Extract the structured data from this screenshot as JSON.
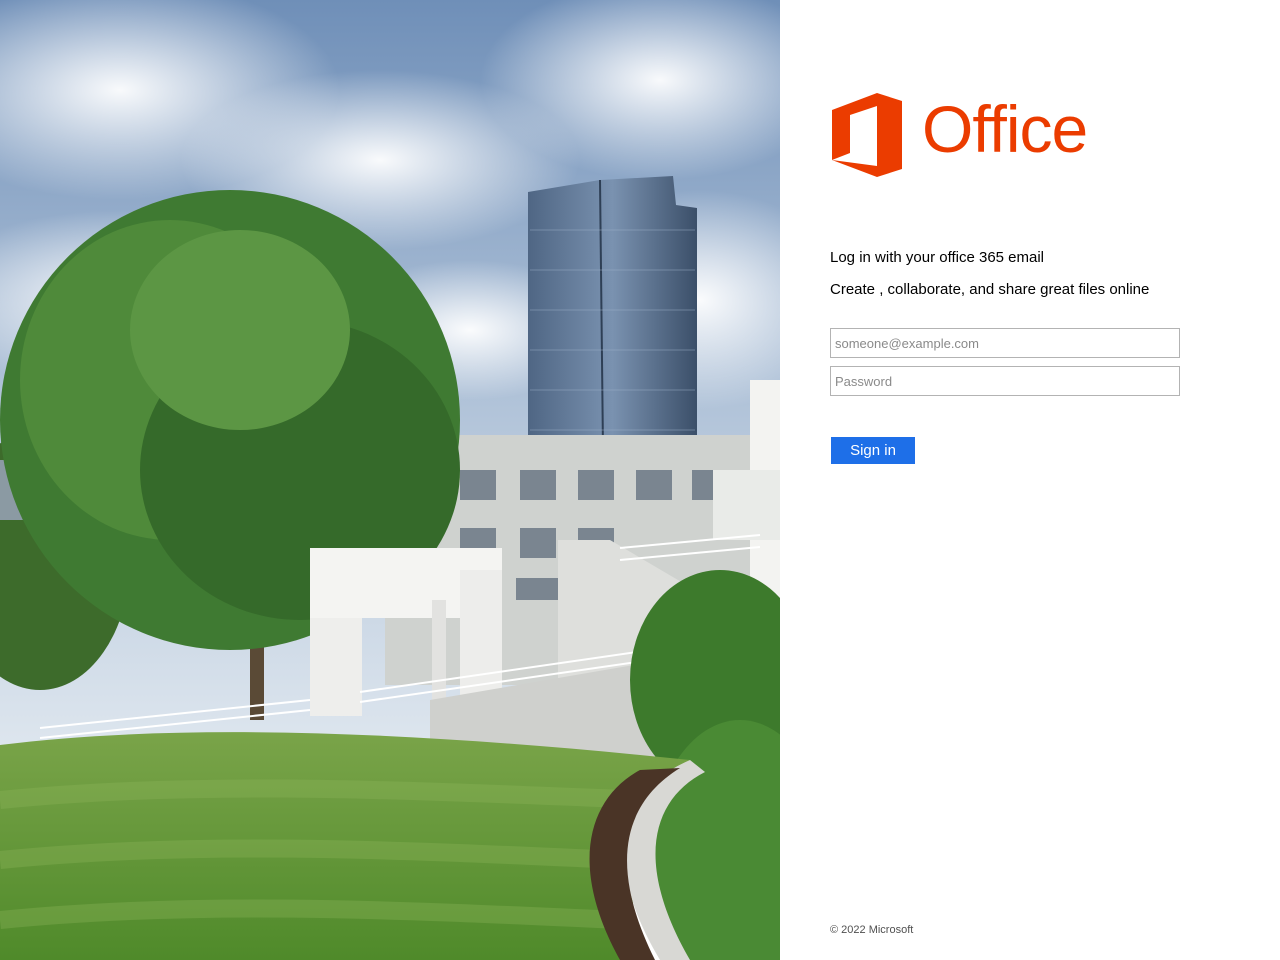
{
  "panel": {
    "logo_text": "Office",
    "headline": "Log in with your office 365 email",
    "subline": "Create , collaborate, and share great files online"
  },
  "form": {
    "email_placeholder": "someone@example.com",
    "email_value": "",
    "password_placeholder": "Password",
    "password_value": "",
    "signin_label": "Sign in"
  },
  "footer": {
    "copyright": "© 2022 Microsoft"
  },
  "colors": {
    "brand": "#eb3c00",
    "button": "#1e6fe8"
  },
  "icons": {
    "logo": "office-logo-icon"
  }
}
